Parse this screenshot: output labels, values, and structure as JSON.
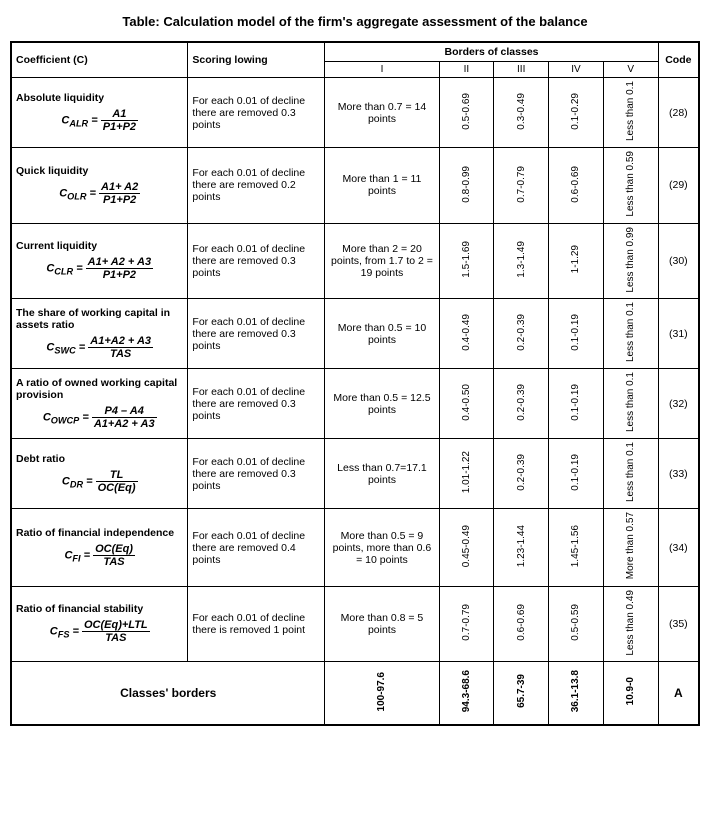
{
  "title": "Table: Calculation model of the firm's aggregate assessment of the balance",
  "headers": {
    "coefficient": "Coefficient (C)",
    "scoring": "Scoring lowing",
    "borders": "Borders of classes",
    "class1": "I",
    "class2": "II",
    "class3": "III",
    "class4": "IV",
    "class5": "V",
    "code": "Code"
  },
  "rows": [
    {
      "name": "Absolute liquidity",
      "formula_label": "C",
      "formula_sub": "ALR",
      "formula_numer": "A1",
      "formula_denom": "P1+P2",
      "scoring": "For each 0.01 of decline there are removed 0.3 points",
      "class1": "More than 0.7 = 14 points",
      "class2": "0.5-0.69",
      "class3": "0.3-0.49",
      "class4": "0.1-0.29",
      "class5": "Less than 0.1",
      "code": "(28)"
    },
    {
      "name": "Quick liquidity",
      "formula_label": "C",
      "formula_sub": "OLR",
      "formula_numer": "A1+ A2",
      "formula_denom": "P1+P2",
      "scoring": "For each 0.01 of decline there are removed 0.2 points",
      "class1": "More than 1 = 11 points",
      "class2": "0.8-0.99",
      "class3": "0.7-0.79",
      "class4": "0.6-0.69",
      "class5": "Less than 0.59",
      "code": "(29)"
    },
    {
      "name": "Current liquidity",
      "formula_label": "C",
      "formula_sub": "CLR",
      "formula_numer": "A1+ A2 + A3",
      "formula_denom": "P1+P2",
      "scoring": "For each 0.01 of decline there are removed 0.3 points",
      "class1": "More than 2 = 20 points, from 1.7 to 2 = 19 points",
      "class2": "1.5-1.69",
      "class3": "1.3-1.49",
      "class4": "1-1.29",
      "class5": "Less than 0.99",
      "code": "(30)"
    },
    {
      "name": "The share of working capital in assets ratio",
      "formula_label": "C",
      "formula_sub": "SWC",
      "formula_numer": "A1+A2 + A3",
      "formula_denom": "TAS",
      "scoring": "For each 0.01 of decline there are removed 0.3 points",
      "class1": "More than 0.5 = 10 points",
      "class2": "0.4-0.49",
      "class3": "0.2-0.39",
      "class4": "0.1-0.19",
      "class5": "Less than 0.1",
      "code": "(31)"
    },
    {
      "name": "A ratio of owned working capital provision",
      "formula_label": "C",
      "formula_sub": "OWCP",
      "formula_numer": "P4 – A4",
      "formula_denom": "A1+A2 + A3",
      "scoring": "For each 0.01 of decline there are removed 0.3 points",
      "class1": "More than 0.5 = 12.5 points",
      "class2": "0.4-0.50",
      "class3": "0.2-0.39",
      "class4": "0.1-0.19",
      "class5": "Less than 0.1",
      "code": "(32)"
    },
    {
      "name": "Debt ratio",
      "formula_label": "C",
      "formula_sub": "DR",
      "formula_numer": "TL",
      "formula_denom": "OC(Eq)",
      "scoring": "For each 0.01 of decline there are removed 0.3 points",
      "class1": "Less than 0.7=17.1 points",
      "class2": "1.01-1.22",
      "class3": "0.2-0.39",
      "class4": "0.1-0.19",
      "class5": "Less than 0.1",
      "code": "(33)"
    },
    {
      "name": "Ratio of financial independence",
      "formula_label": "C",
      "formula_sub": "FI",
      "formula_numer": "OC(Eq)",
      "formula_denom": "TAS",
      "scoring": "For each 0.01 of decline there are removed 0.4 points",
      "class1": "More than 0.5 = 9 points, more than 0.6 = 10 points",
      "class2": "0.45-0.49",
      "class3": "1.23-1.44",
      "class4": "1.45-1.56",
      "class5": "More than 0.57",
      "code": "(34)"
    },
    {
      "name": "Ratio of financial stability",
      "formula_label": "C",
      "formula_sub": "FS",
      "formula_numer": "OC(Eq)+LTL",
      "formula_denom": "TAS",
      "scoring": "For each 0.01 of decline there is removed 1 point",
      "class1": "More than 0.8 = 5 points",
      "class2": "0.7-0.79",
      "class3": "0.6-0.69",
      "class4": "0.5-0.59",
      "class5": "Less than 0.49",
      "code": "(35)"
    }
  ],
  "classes_border": {
    "label": "Classes' borders",
    "class1": "100-97.6",
    "class2": "94.3-68.6",
    "class3": "65.7-39",
    "class4": "36.1-13.8",
    "class5": "10.9-0",
    "code": "A"
  }
}
